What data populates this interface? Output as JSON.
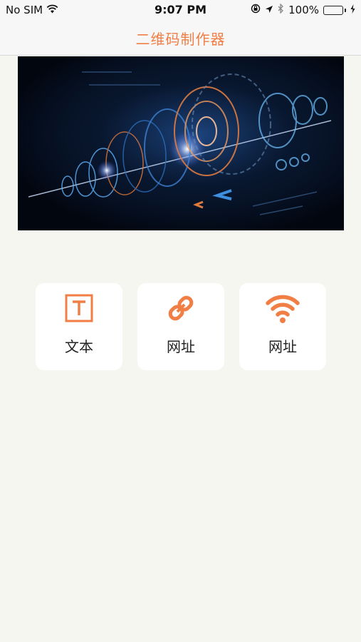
{
  "status_bar": {
    "carrier": "No SIM",
    "time": "9:07 PM",
    "battery_percent": "100%"
  },
  "nav": {
    "title": "二维码制作器"
  },
  "banner": {
    "description_icon": "futuristic-tech-banner-image"
  },
  "cards": [
    {
      "label": "文本",
      "icon": "text-icon"
    },
    {
      "label": "网址",
      "icon": "link-icon"
    },
    {
      "label": "网址",
      "icon": "wifi-icon"
    }
  ],
  "colors": {
    "accent": "#f07e45",
    "background": "#f6f6f1",
    "card": "#ffffff",
    "battery": "#3fd33f"
  }
}
